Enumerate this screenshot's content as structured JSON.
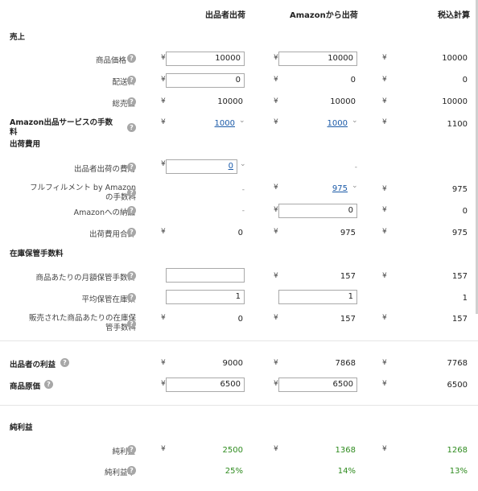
{
  "headers": {
    "col1": "出品者出荷",
    "col2": "Amazonから出荷",
    "col3": "税込計算"
  },
  "currency": "¥",
  "dash": "-",
  "help_glyph": "?",
  "chevron_glyph": "⌄",
  "sections": {
    "sales": "売上",
    "shipping_costs": "出荷費用",
    "storage_fees": "在庫保管手数料",
    "net_profit": "純利益"
  },
  "rows": {
    "item_price": {
      "label": "商品価格",
      "c1": "10000",
      "c2": "10000",
      "c3": "10000"
    },
    "shipping_fee": {
      "label": "配送料",
      "c1": "0",
      "c2": "0",
      "c3": "0"
    },
    "total_revenue": {
      "label": "総売上",
      "c1": "10000",
      "c2": "10000",
      "c3": "10000"
    },
    "amazon_fees": {
      "label_line1": "Amazon出品サービスの手数",
      "label_line2": "料",
      "c1": "1000",
      "c2": "1000",
      "c3": "1100"
    },
    "merchant_ship_cost": {
      "label": "出品者出荷の費用",
      "c1": "0"
    },
    "fba_fee": {
      "label_line1": "フルフィルメント by Amazon",
      "label_line2": "の手数料",
      "c2": "975",
      "c3": "975"
    },
    "inbound": {
      "label": "Amazonへの納品",
      "c2": "0",
      "c3": "0"
    },
    "shipping_total": {
      "label": "出荷費用合計",
      "c1": "0",
      "c2": "975",
      "c3": "975"
    },
    "monthly_storage": {
      "label": "商品あたりの月額保管手数料",
      "c1": "",
      "c2": "157",
      "c3": "157"
    },
    "avg_inventory": {
      "label": "平均保管在庫数",
      "c1": "1",
      "c2": "1",
      "c3": "1"
    },
    "storage_per_sold": {
      "label_line1": "販売された商品あたりの在庫保",
      "label_line2": "管手数料",
      "c1": "0",
      "c2": "157",
      "c3": "157"
    },
    "seller_profit": {
      "label": "出品者の利益",
      "c1": "9000",
      "c2": "7868",
      "c3": "7768"
    },
    "cost_of_goods": {
      "label": "商品原価",
      "c1": "6500",
      "c2": "6500",
      "c3": "6500"
    },
    "net_profit": {
      "label": "純利益",
      "c1": "2500",
      "c2": "1368",
      "c3": "1268"
    },
    "net_margin": {
      "label": "純利益率",
      "c1": "25%",
      "c2": "14%",
      "c3": "13%"
    }
  },
  "colors": {
    "positive": "#2e8b1e",
    "link": "#1b5aa8"
  }
}
